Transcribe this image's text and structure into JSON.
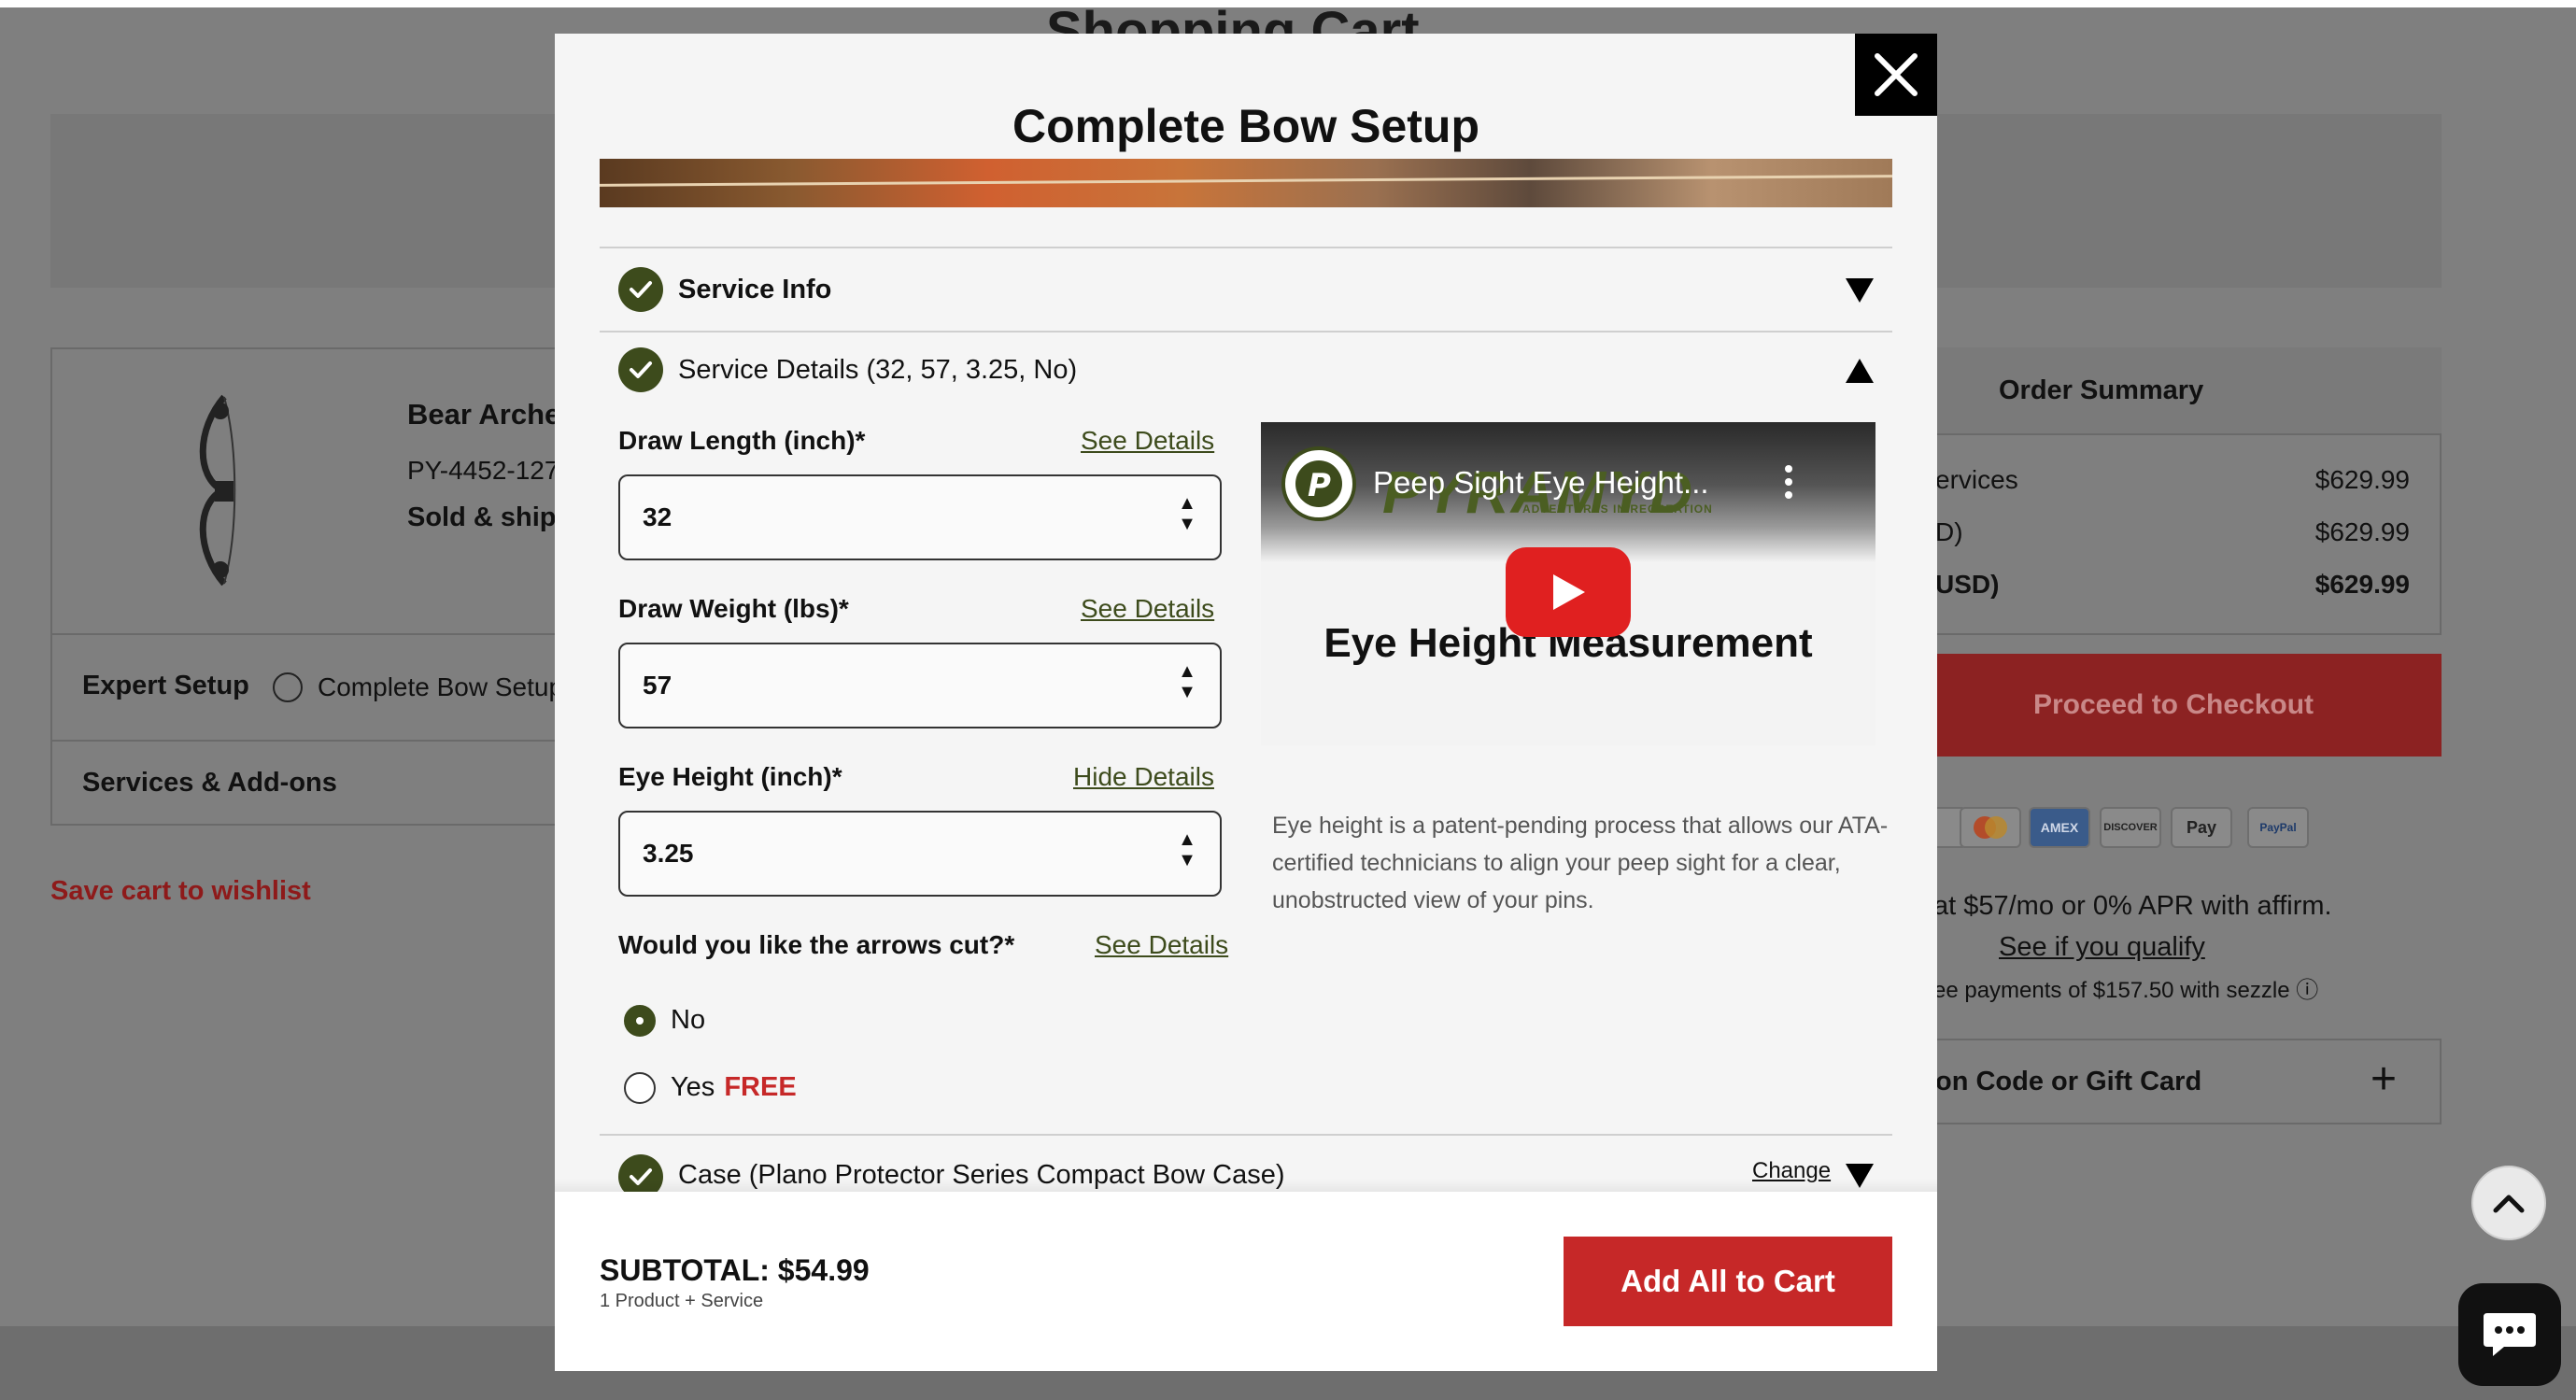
{
  "background": {
    "page_title": "Shopping Cart",
    "product": {
      "name": "Bear Arche",
      "sku": "PY-4452-127",
      "sold_by": "Sold & shipp"
    },
    "expert_setup_label": "Expert Setup",
    "expert_setup_option": "Complete Bow Setup",
    "services_label": "Services & Add-ons",
    "save_cart_link": "Save cart to wishlist",
    "order_summary": {
      "title": "Order Summary",
      "rows": [
        {
          "label": "ervices",
          "value": "$629.99"
        },
        {
          "label": "D)",
          "value": "$629.99"
        },
        {
          "label": "USD)",
          "value": "$629.99"
        }
      ]
    },
    "checkout_button": "Proceed to Checkout",
    "payment_methods": [
      "",
      "",
      "AMEX",
      "DISCOVER",
      "Pay",
      "PayPal"
    ],
    "affirm_text": "at $57/mo or 0% APR with affirm.",
    "affirm_link": "See if you qualify",
    "sezzle_text": "ee payments of $157.50 with sezzle ⓘ",
    "promo_label": "on Code or Gift Card",
    "promo_plus": "+"
  },
  "modal": {
    "title": "Complete Bow Setup",
    "close_icon": "close-icon",
    "sections": {
      "service_info": "Service Info",
      "service_details": "Service Details (32, 57, 3.25, No)",
      "case": "Case (Plano Protector Series Compact Bow Case)",
      "case_change": "Change"
    },
    "fields": {
      "draw_length": {
        "label": "Draw Length (inch)*",
        "value": "32",
        "link": "See Details"
      },
      "draw_weight": {
        "label": "Draw Weight (lbs)*",
        "value": "57",
        "link": "See Details"
      },
      "eye_height": {
        "label": "Eye Height (inch)*",
        "value": "3.25",
        "link": "Hide Details"
      }
    },
    "arrows_question": {
      "label": "Would you like the arrows cut?*",
      "link": "See Details",
      "options": [
        {
          "label": "No",
          "selected": true
        },
        {
          "label": "Yes",
          "badge": "FREE",
          "selected": false
        }
      ]
    },
    "video": {
      "channel_logo_text": "PYRAMYD",
      "channel_logo_sub": "ADVENTURES IN RECREATION",
      "title": "Peep Sight Eye Height...",
      "heading_line1": "H                :",
      "heading_line2": "Eye Height Measurement"
    },
    "description": "Eye height is a patent-pending process that allows our ATA-certified technicians to align your peep sight for a clear, unobstructed view of your pins.",
    "footer": {
      "subtotal": "SUBTOTAL: $54.99",
      "subtotal_sub": "1 Product + Service",
      "add_button": "Add All to Cart"
    }
  },
  "colors": {
    "accent_green": "#3d4b1c",
    "cta_red": "#c62828",
    "overlay_gray": "#7f7f7f"
  }
}
